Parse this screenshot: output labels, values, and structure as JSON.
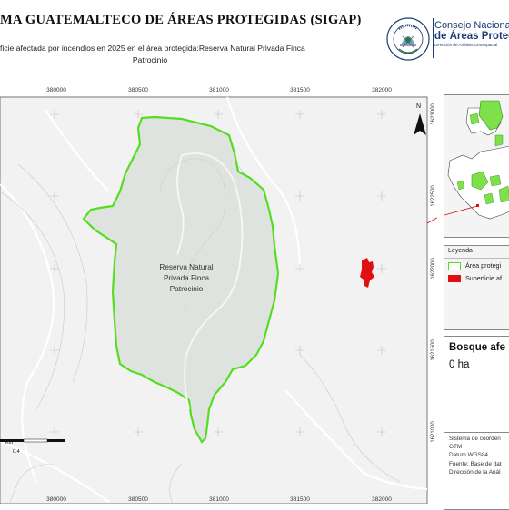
{
  "header": {
    "title": "MA GUATEMALTECO DE ÁREAS PROTEGIDAS  (SIGAP)",
    "subtitle_line1": "ficie afectada por incendios en 2025 en el área protegida:Reserva Natural Privada Finca",
    "subtitle_line2": "Patrocinio"
  },
  "logos": {
    "seal_ring_text": "GOBIERNO DE LA REPÚBLICA",
    "seal_bottom_text": "GUATEMALA",
    "cnap_line1": "Consejo Nacional",
    "cnap_line2": "de Áreas Protegi",
    "cnap_line3": "Dirección de Análisis Geoespacial"
  },
  "map": {
    "x_ticks": [
      "380000",
      "380500",
      "381000",
      "381500",
      "382000"
    ],
    "y_ticks": [
      "1623000",
      "1622500",
      "1622000",
      "1621500",
      "1621000"
    ],
    "protected_area_label": [
      "Reserva Natural",
      "Privada Finca",
      "Patrocinio"
    ],
    "north_label": "N",
    "scale_unit": "Km",
    "scale_value": "0.4",
    "colors": {
      "background": "#f2f2f2",
      "area_fill": "#dfe3df",
      "area_outline": "#55dd22",
      "burned": "#e01010",
      "grid": "#cfcfcf",
      "roads": "#ffffff"
    }
  },
  "legend": {
    "title": "Leyenda",
    "items": [
      {
        "label": "Área protegi",
        "swatch": "outline",
        "color": "#55dd22"
      },
      {
        "label": "Superficie af",
        "swatch": "fill",
        "color": "#e01010"
      }
    ]
  },
  "stat": {
    "label": "Bosque afe",
    "value": "0 ha"
  },
  "metadata": {
    "lines": [
      "Sistema de coorden",
      "GTM",
      "Datum WGS84",
      "Fuente: Base de dat",
      "Dirección de la Anál"
    ]
  }
}
